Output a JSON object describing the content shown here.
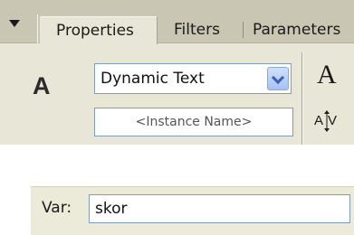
{
  "tabs": {
    "properties": "Properties",
    "filters": "Filters",
    "parameters": "Parameters"
  },
  "properties_panel": {
    "symbol_letter": "A",
    "text_type": {
      "selected": "Dynamic Text"
    },
    "instance_name": {
      "value": "",
      "placeholder": "<Instance Name>"
    },
    "font_icon_glyph": "A",
    "kerning_icon": "letter-spacing-icon"
  },
  "var_field": {
    "label": "Var:",
    "value": "skor"
  },
  "colors": {
    "panel_bg": "#e8e6d6",
    "tabstrip_bg": "#c9c7b4",
    "input_border": "#7f9db9",
    "dropdown_button": "#a6c2f4"
  }
}
